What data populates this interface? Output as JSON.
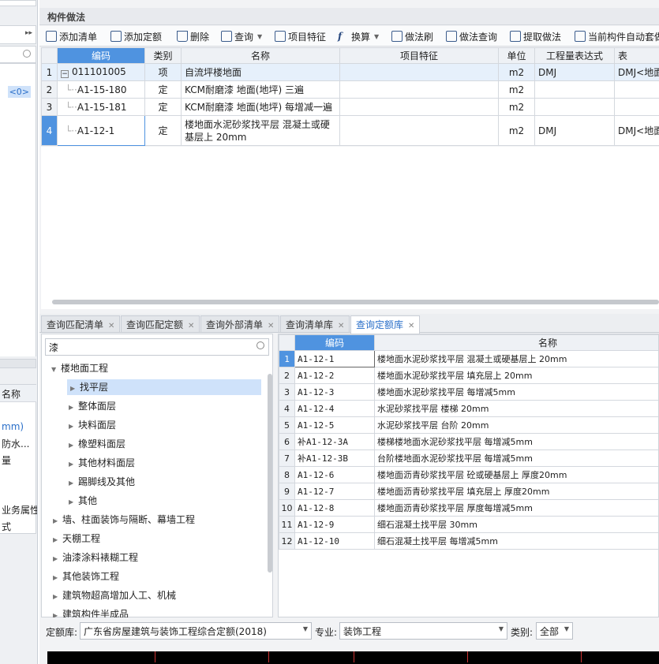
{
  "left_pane": {
    "badge": "<0>",
    "items": [
      "名称",
      "mm)",
      "防水...",
      "量",
      "业务属性",
      "式"
    ]
  },
  "panel": {
    "title": "构件做法"
  },
  "toolbar": {
    "add_list": "添加清单",
    "add_quota": "添加定额",
    "delete": "删除",
    "query": "查询",
    "item_feature": "项目特征",
    "convert": "换算",
    "method_brush": "做法刷",
    "method_query": "做法查询",
    "extract_method": "提取做法",
    "auto_apply": "当前构件自动套做法"
  },
  "top_table": {
    "headers": [
      "编码",
      "类别",
      "名称",
      "项目特征",
      "单位",
      "工程量表达式",
      "表"
    ],
    "rows": [
      {
        "num": "1",
        "code": "011101005",
        "type": "项",
        "name": "自流坪楼地面",
        "feature": "",
        "unit": "m2",
        "expr": "DMJ",
        "expr2": "DMJ<地面"
      },
      {
        "num": "2",
        "code": "A1-15-180",
        "type": "定",
        "name": "KCM耐磨漆 地面(地坪) 三遍",
        "feature": "",
        "unit": "m2",
        "expr": "",
        "expr2": ""
      },
      {
        "num": "3",
        "code": "A1-15-181",
        "type": "定",
        "name": "KCM耐磨漆 地面(地坪) 每增减一遍",
        "feature": "",
        "unit": "m2",
        "expr": "",
        "expr2": ""
      },
      {
        "num": "4",
        "code": "A1-12-1",
        "type": "定",
        "name": "楼地面水泥砂浆找平层 混凝土或硬基层上 20mm",
        "feature": "",
        "unit": "m2",
        "expr": "DMJ",
        "expr2": "DMJ<地面"
      }
    ]
  },
  "tabs": [
    {
      "label": "查询匹配清单"
    },
    {
      "label": "查询匹配定额"
    },
    {
      "label": "查询外部清单"
    },
    {
      "label": "查询清单库"
    },
    {
      "label": "查询定额库"
    }
  ],
  "tree": {
    "search_value": "漆",
    "nodes": [
      {
        "label": "楼地面工程",
        "level": 0,
        "expanded": true
      },
      {
        "label": "找平层",
        "level": 1,
        "selected": true
      },
      {
        "label": "整体面层",
        "level": 1
      },
      {
        "label": "块料面层",
        "level": 1
      },
      {
        "label": "橡塑料面层",
        "level": 1
      },
      {
        "label": "其他材料面层",
        "level": 1
      },
      {
        "label": "踢脚线及其他",
        "level": 1
      },
      {
        "label": "其他",
        "level": 1
      },
      {
        "label": "墙、柱面装饰与隔断、幕墙工程",
        "level": 0
      },
      {
        "label": "天棚工程",
        "level": 0
      },
      {
        "label": "油漆涂料裱糊工程",
        "level": 0
      },
      {
        "label": "其他装饰工程",
        "level": 0
      },
      {
        "label": "建筑物超高增加人工、机械",
        "level": 0
      },
      {
        "label": "建筑构件半成品",
        "level": 0
      }
    ]
  },
  "quota_table": {
    "headers": [
      "编码",
      "名称"
    ],
    "rows": [
      {
        "num": "1",
        "code": "A1-12-1",
        "name": "楼地面水泥砂浆找平层 混凝土或硬基层上 20mm"
      },
      {
        "num": "2",
        "code": "A1-12-2",
        "name": "楼地面水泥砂浆找平层 填充层上 20mm"
      },
      {
        "num": "3",
        "code": "A1-12-3",
        "name": "楼地面水泥砂浆找平层 每增减5mm"
      },
      {
        "num": "4",
        "code": "A1-12-4",
        "name": "水泥砂浆找平层 楼梯 20mm"
      },
      {
        "num": "5",
        "code": "A1-12-5",
        "name": "水泥砂浆找平层 台阶 20mm"
      },
      {
        "num": "6",
        "code": "补A1-12-3A",
        "name": "楼梯楼地面水泥砂浆找平层 每增减5mm"
      },
      {
        "num": "7",
        "code": "补A1-12-3B",
        "name": "台阶楼地面水泥砂浆找平层 每增减5mm"
      },
      {
        "num": "8",
        "code": "A1-12-6",
        "name": "楼地面沥青砂浆找平层 砼或硬基层上 厚度20mm"
      },
      {
        "num": "9",
        "code": "A1-12-7",
        "name": "楼地面沥青砂浆找平层 填充层上 厚度20mm"
      },
      {
        "num": "10",
        "code": "A1-12-8",
        "name": "楼地面沥青砂浆找平层 厚度每增减5mm"
      },
      {
        "num": "11",
        "code": "A1-12-9",
        "name": "细石混凝土找平层 30mm"
      },
      {
        "num": "12",
        "code": "A1-12-10",
        "name": "细石混凝土找平层 每增减5mm"
      }
    ]
  },
  "bottom": {
    "quota_lib_label": "定额库:",
    "quota_lib_value": "广东省房屋建筑与装饰工程综合定额(2018)",
    "specialty_label": "专业:",
    "specialty_value": "装饰工程",
    "category_label": "类别:",
    "category_value": "全部"
  },
  "colors": {
    "accent": "#4f93e0",
    "selected_row": "#e6f0fb",
    "tree_selected": "#cfe2fa"
  }
}
